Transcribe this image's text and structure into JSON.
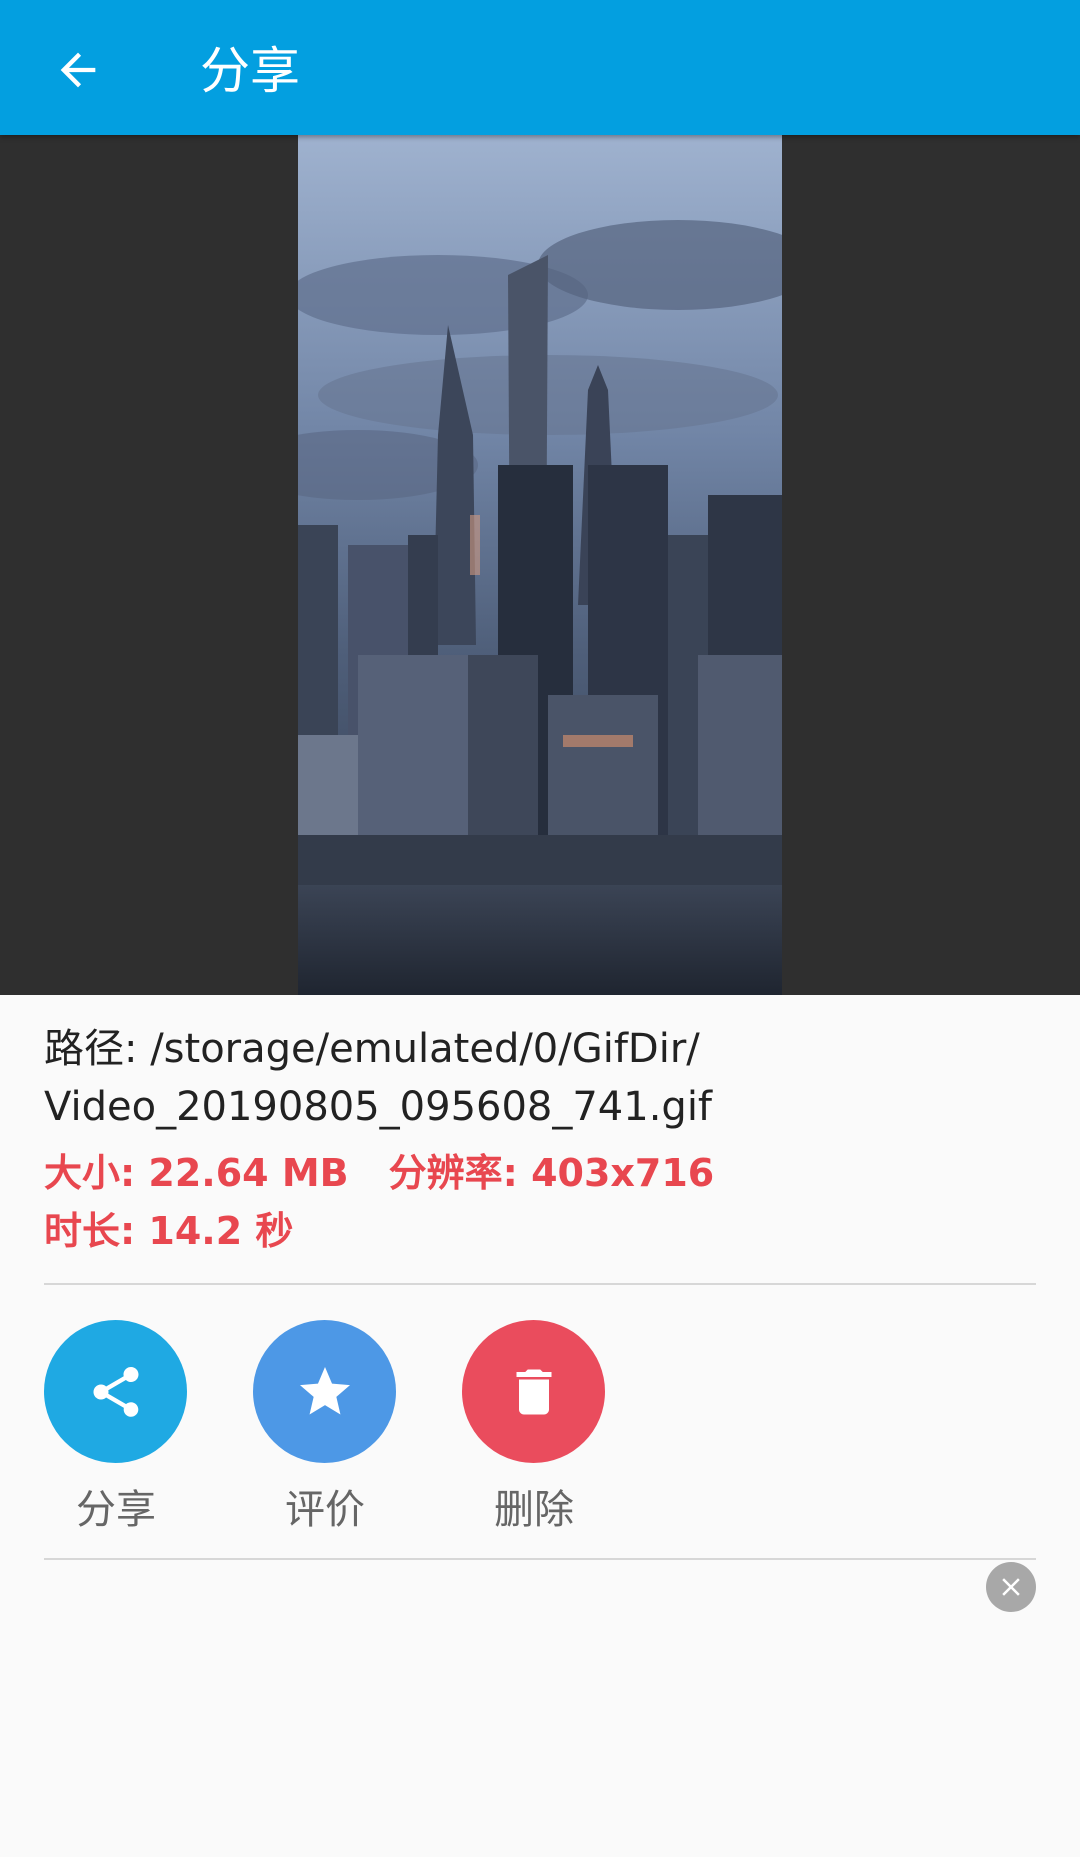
{
  "appbar": {
    "title": "分享",
    "back_icon": "arrow-back-icon",
    "background": "#039fe0"
  },
  "preview": {
    "background": "#2f2f2f"
  },
  "info": {
    "path_line1": "路径: /storage/emulated/0/GifDir/",
    "path_line2": "Video_20190805_095608_741.gif",
    "size": "大小: 22.64 MB",
    "resolution": "分辨率: 403x716",
    "duration": "时长: 14.2 秒",
    "accent_color": "#e8474f"
  },
  "actions": [
    {
      "label": "分享",
      "icon": "share-icon",
      "color": "#1fa9e3"
    },
    {
      "label": "评价",
      "icon": "star-icon",
      "color": "#4d98e6"
    },
    {
      "label": "删除",
      "icon": "trash-icon",
      "color": "#ea4c5d"
    }
  ],
  "ad_close_icon": "close-circle-icon"
}
